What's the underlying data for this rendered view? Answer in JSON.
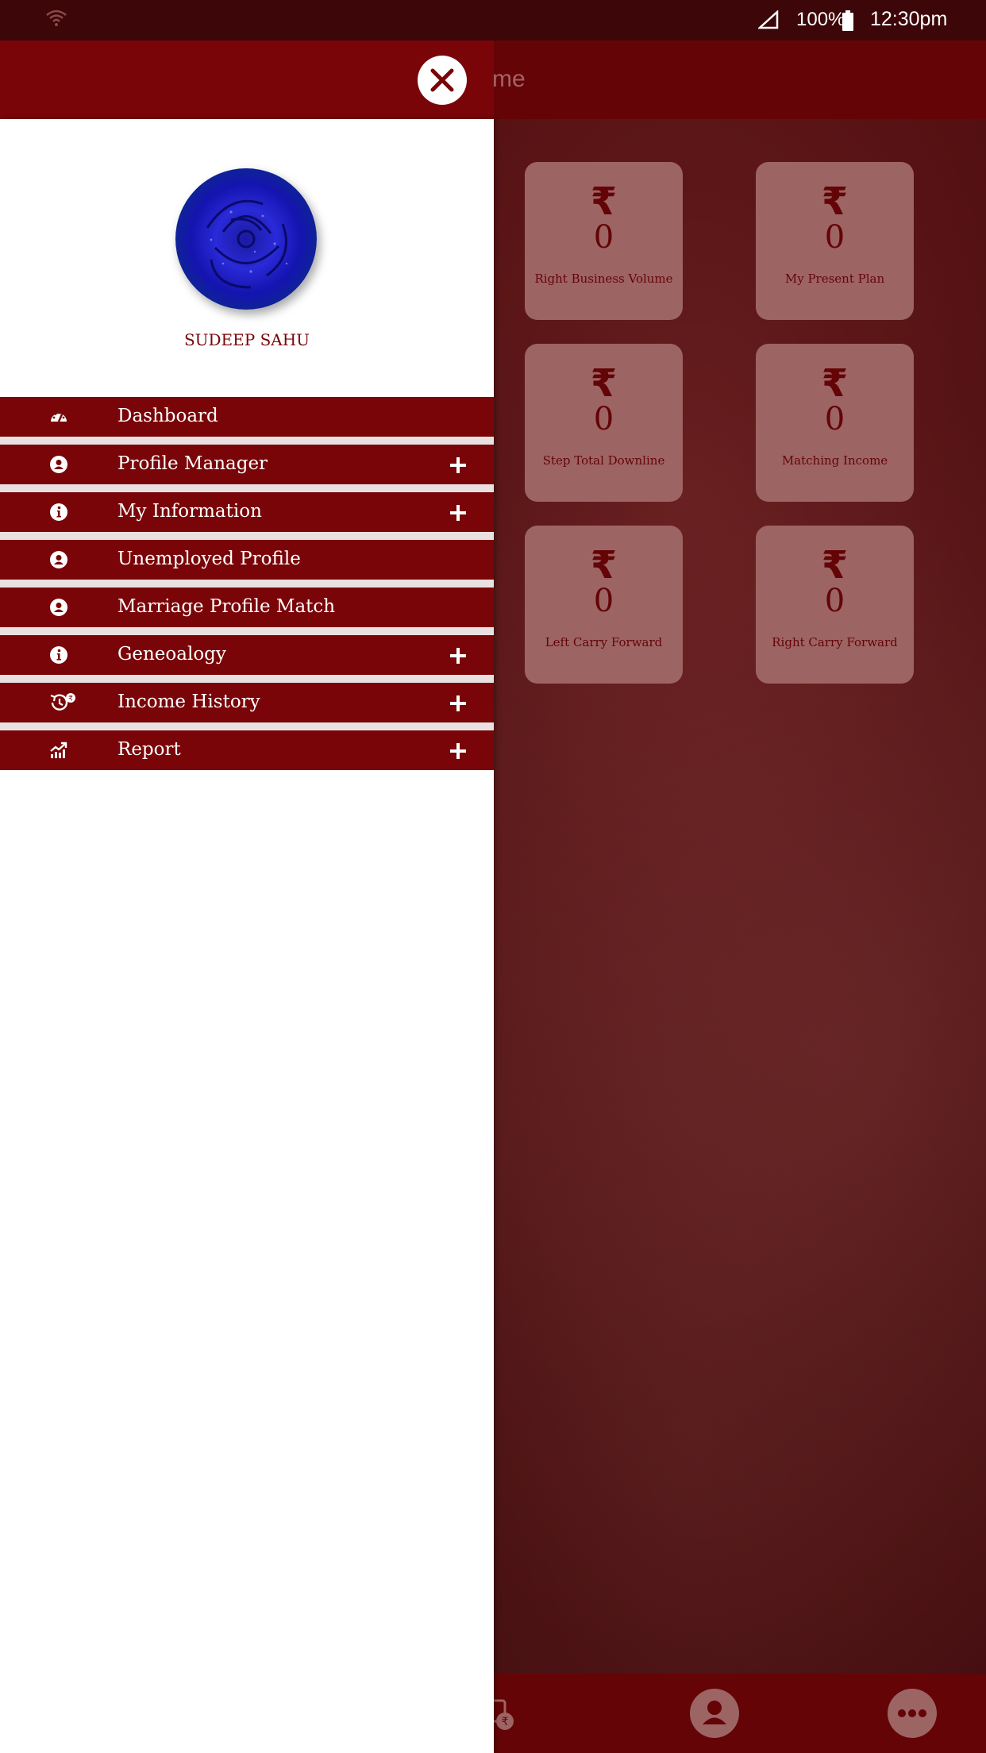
{
  "status_bar": {
    "battery_pct": "100%",
    "time": "12:30pm"
  },
  "app_bar": {
    "title_fragment": "me"
  },
  "cards": [
    {
      "currency": "₹",
      "value": "0",
      "label": "Right Business Volume"
    },
    {
      "currency": "₹",
      "value": "0",
      "label": "My Present Plan"
    },
    {
      "currency": "₹",
      "value": "0",
      "label": "Step Total Downline"
    },
    {
      "currency": "₹",
      "value": "0",
      "label": "Matching Income"
    },
    {
      "currency": "₹",
      "value": "0",
      "label": "Left Carry Forward"
    },
    {
      "currency": "₹",
      "value": "0",
      "label": "Right Carry Forward"
    }
  ],
  "drawer": {
    "user_name": "SUDEEP SAHU",
    "menu": [
      {
        "label": "Dashboard",
        "icon": "dashboard-icon",
        "expandable": false
      },
      {
        "label": "Profile Manager",
        "icon": "user-circle-icon",
        "expandable": true
      },
      {
        "label": "My Information",
        "icon": "info-icon",
        "expandable": true
      },
      {
        "label": "Unemployed Profile",
        "icon": "user-circle-icon",
        "expandable": false
      },
      {
        "label": "Marriage Profile Match",
        "icon": "user-circle-icon",
        "expandable": false
      },
      {
        "label": "Geneoalogy",
        "icon": "info-icon",
        "expandable": true
      },
      {
        "label": "Income History",
        "icon": "history-rupee-icon",
        "expandable": true
      },
      {
        "label": "Report",
        "icon": "chart-up-icon",
        "expandable": true
      }
    ]
  },
  "colors": {
    "primary": "#7a0508",
    "card": "#c07a7b",
    "separator": "#e9e1e1"
  }
}
